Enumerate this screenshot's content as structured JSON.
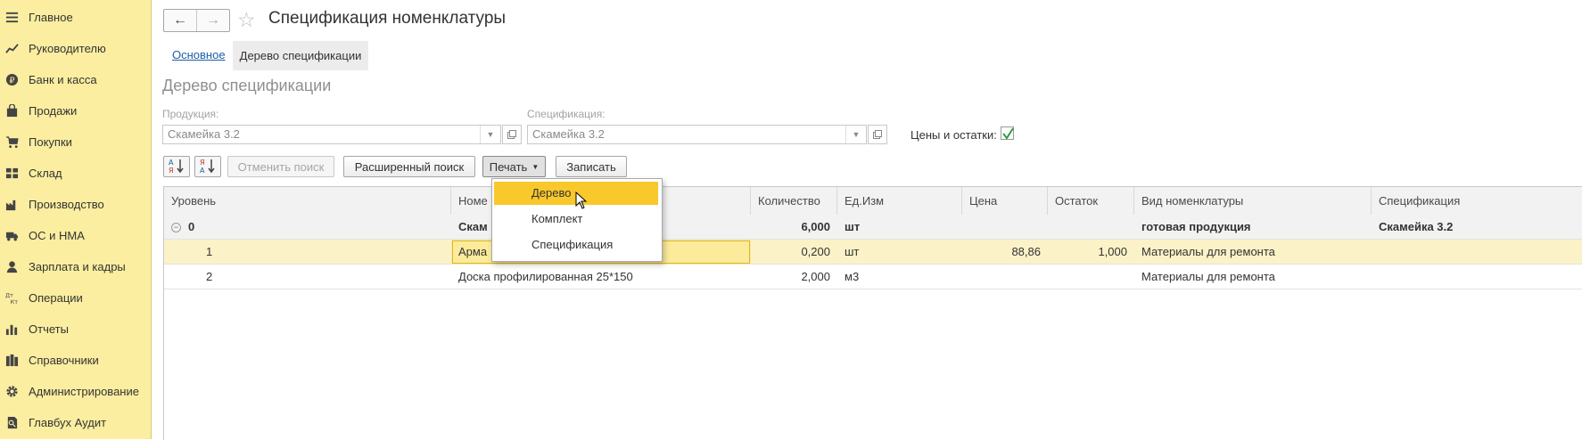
{
  "sidebar": {
    "items": [
      {
        "label": "Главное",
        "icon": "menu-icon"
      },
      {
        "label": "Руководителю",
        "icon": "chart-line-icon"
      },
      {
        "label": "Банк и касса",
        "icon": "ruble-coin-icon"
      },
      {
        "label": "Продажи",
        "icon": "shopping-bag-icon"
      },
      {
        "label": "Покупки",
        "icon": "cart-icon"
      },
      {
        "label": "Склад",
        "icon": "warehouse-grid-icon"
      },
      {
        "label": "Производство",
        "icon": "factory-icon"
      },
      {
        "label": "ОС и НМА",
        "icon": "truck-icon"
      },
      {
        "label": "Зарплата и кадры",
        "icon": "person-icon"
      },
      {
        "label": "Операции",
        "icon": "debit-credit-icon"
      },
      {
        "label": "Отчеты",
        "icon": "bar-chart-icon"
      },
      {
        "label": "Справочники",
        "icon": "books-icon"
      },
      {
        "label": "Администрирование",
        "icon": "gear-icon"
      },
      {
        "label": "Главбух Аудит",
        "icon": "audit-icon"
      }
    ]
  },
  "header": {
    "title": "Спецификация номенклатуры"
  },
  "tabs": {
    "basic": "Основное",
    "tree": "Дерево спецификации"
  },
  "section_title": "Дерево спецификации",
  "filters": {
    "product_label": "Продукция:",
    "product_value": "Скамейка 3.2",
    "spec_label": "Спецификация:",
    "spec_value": "Скамейка 3.2",
    "prices_label": "Цены и остатки:",
    "prices_checked": true
  },
  "toolbar": {
    "cancel_search": "Отменить поиск",
    "advanced_search": "Расширенный поиск",
    "print": "Печать",
    "save": "Записать"
  },
  "table": {
    "columns": [
      "Уровень",
      "Номенклатура",
      "Количество",
      "Ед.Изм",
      "Цена",
      "Остаток",
      "Вид номенклатуры",
      "Спецификация"
    ],
    "header_visible": {
      "level": "Уровень",
      "name": "Номе",
      "qty": "Количество",
      "unit": "Ед.Изм",
      "price": "Цена",
      "stock": "Остаток",
      "kind": "Вид номенклатуры",
      "spec": "Спецификация"
    },
    "rows": [
      {
        "level": "0",
        "name": "Скам",
        "qty": "6,000",
        "unit": "шт",
        "price": "",
        "stock": "",
        "kind": "готовая продукция",
        "spec": "Скамейка 3.2"
      },
      {
        "level": "1",
        "name": "Арма",
        "qty": "0,200",
        "unit": "шт",
        "price": "88,86",
        "stock": "1,000",
        "kind": "Материалы для ремонта",
        "spec": ""
      },
      {
        "level": "2",
        "name": "Доска профилированная 25*150",
        "qty": "2,000",
        "unit": "м3",
        "price": "",
        "stock": "",
        "kind": "Материалы для ремонта",
        "spec": ""
      }
    ]
  },
  "print_menu": {
    "items": [
      "Дерево",
      "Комплект",
      "Спецификация"
    ],
    "highlighted": "Дерево"
  },
  "colors": {
    "sidebar_bg": "#fbeea0",
    "highlight": "#f9c82a",
    "link": "#1d5ea8",
    "check": "#2e9e3f"
  }
}
